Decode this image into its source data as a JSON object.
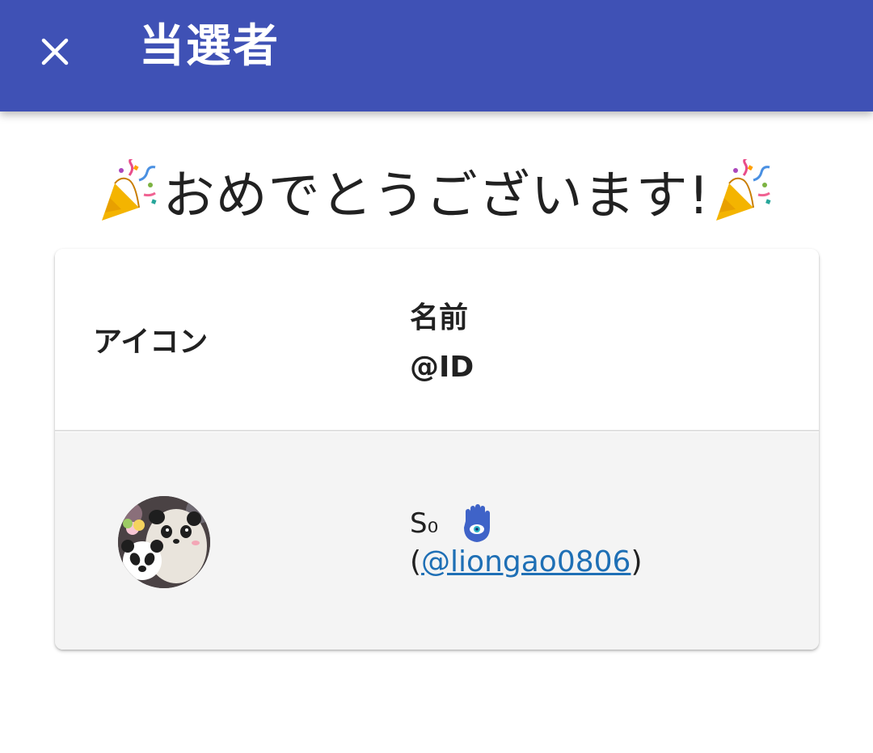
{
  "appbar": {
    "title": "当選者",
    "close_icon": "close-icon",
    "background": "#3f51b5"
  },
  "congrats": {
    "text": "おめでとうございます!",
    "left_icon": "party-popper-icon",
    "right_icon": "party-popper-icon"
  },
  "table": {
    "header": {
      "icon_label": "アイコン",
      "name_label": "名前",
      "id_label": "@ID"
    },
    "rows": [
      {
        "avatar": "panda-avatar",
        "name": "S₀",
        "name_badge_icon": "hamsa-icon",
        "id_open": "(",
        "id": "@liongao0806",
        "id_close": ")"
      }
    ]
  },
  "colors": {
    "link": "#1e6fb5",
    "row_background": "#f4f4f4"
  }
}
